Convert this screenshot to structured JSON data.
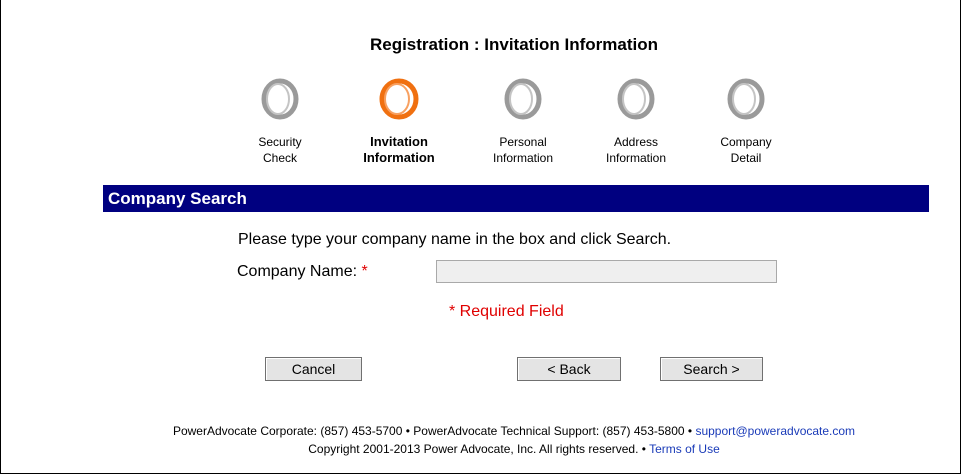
{
  "page": {
    "title": "Registration : Invitation Information"
  },
  "steps": [
    {
      "label": "Security\nCheck",
      "active": false
    },
    {
      "label": "Invitation\nInformation",
      "active": true
    },
    {
      "label": "Personal\nInformation",
      "active": false
    },
    {
      "label": "Address\nInformation",
      "active": false
    },
    {
      "label": "Company\nDetail",
      "active": false
    }
  ],
  "colors": {
    "active_ring": "#f07010",
    "inactive_ring": "#8a8a8a",
    "section_bar": "#000080",
    "required": "#e00000",
    "link": "#1a3bb8"
  },
  "section": {
    "title": "Company Search"
  },
  "form": {
    "instruction": "Please type your company name in the box and click Search.",
    "company_label": "Company Name:",
    "required_star": "*",
    "company_value": "",
    "required_note": "* Required Field"
  },
  "buttons": {
    "cancel": "Cancel",
    "back": "< Back",
    "search": "Search >"
  },
  "footer": {
    "line1_text": "PowerAdvocate Corporate: (857) 453-5700 • PowerAdvocate Technical Support: (857) 453-5800 •",
    "support_email": "support@poweradvocate.com",
    "line2_text": "Copyright 2001-2013 Power Advocate, Inc. All rights reserved. •",
    "terms_link": "Terms of Use"
  }
}
